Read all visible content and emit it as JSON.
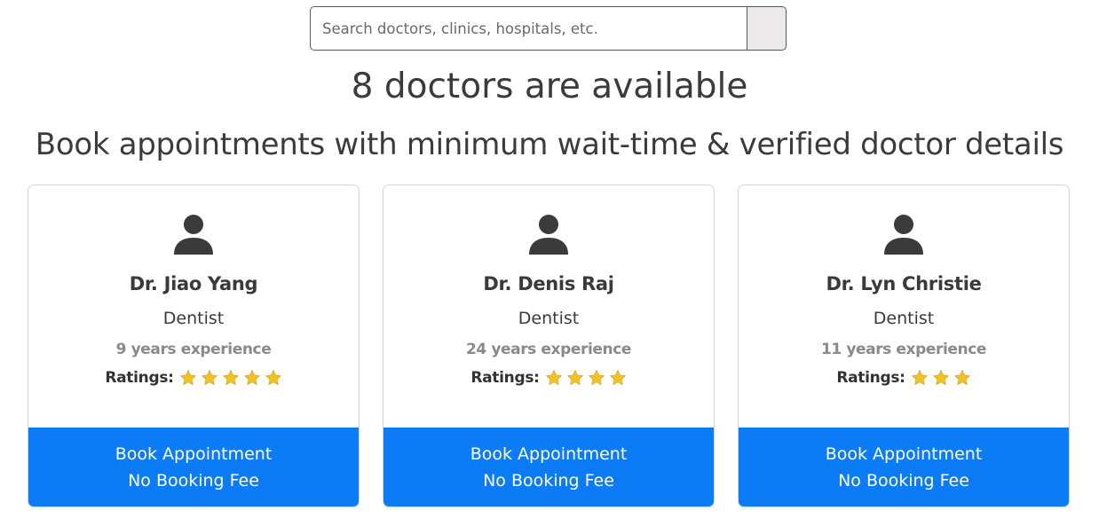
{
  "search": {
    "placeholder": "Search doctors, clinics, hospitals, etc.",
    "value": "",
    "button_icon": "search-icon"
  },
  "header": {
    "count_heading": "8 doctors are available",
    "tagline": "Book appointments with minimum wait-time & verified doctor details"
  },
  "colors": {
    "primary_button": "#0b7cf6",
    "star": "#f2c124",
    "avatar": "#3b3b3b"
  },
  "ratings_label": "Ratings:",
  "doctors": [
    {
      "name": "Dr. Jiao Yang",
      "specialty": "Dentist",
      "experience": "9 years experience",
      "rating": 5,
      "button_line1": "Book Appointment",
      "button_line2": "No Booking Fee"
    },
    {
      "name": "Dr. Denis Raj",
      "specialty": "Dentist",
      "experience": "24 years experience",
      "rating": 4,
      "button_line1": "Book Appointment",
      "button_line2": "No Booking Fee"
    },
    {
      "name": "Dr. Lyn Christie",
      "specialty": "Dentist",
      "experience": "11 years experience",
      "rating": 3,
      "button_line1": "Book Appointment",
      "button_line2": "No Booking Fee"
    }
  ]
}
